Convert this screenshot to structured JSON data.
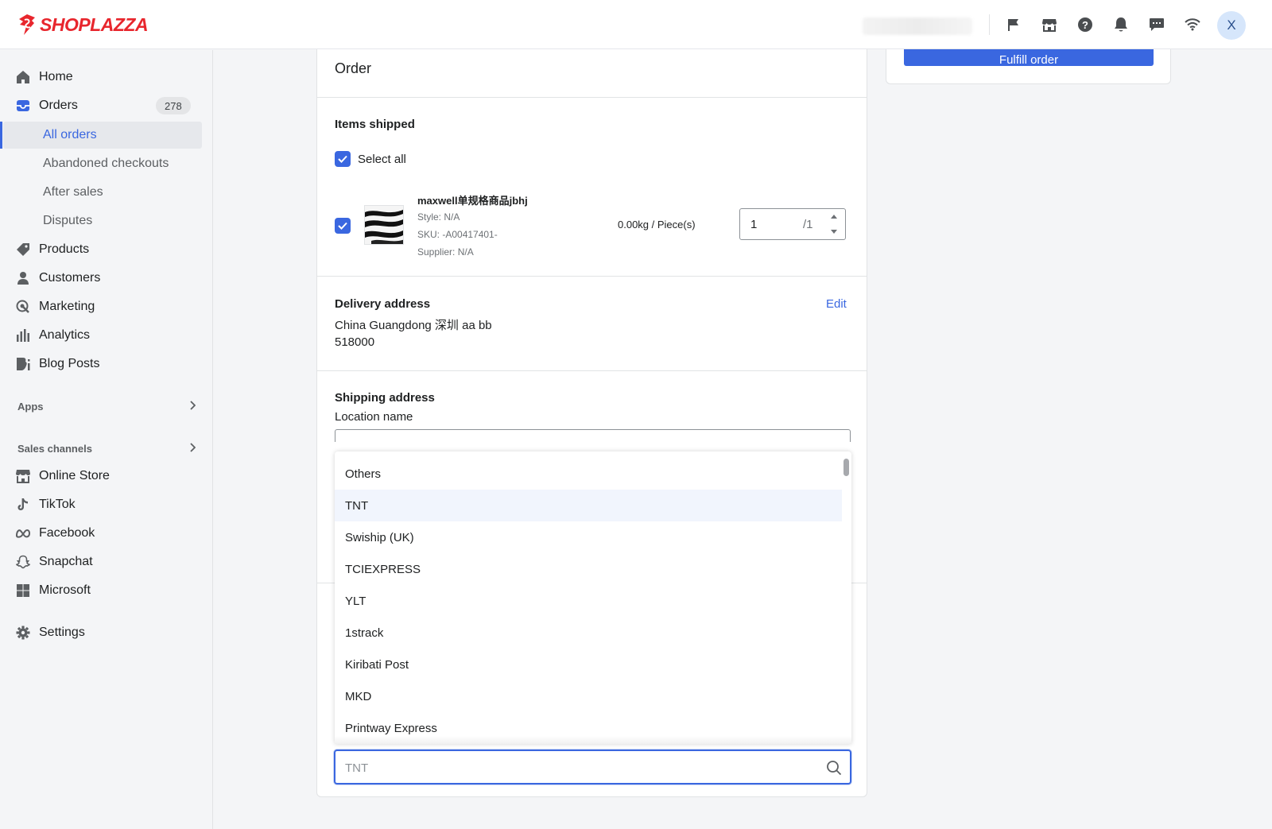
{
  "brand": {
    "name": "SHOPLAZZA",
    "color": "#e8262d"
  },
  "accent": "#3a67e0",
  "topbar": {
    "icons": [
      "flag-icon",
      "store-icon",
      "help-icon",
      "bell-icon",
      "chat-icon",
      "wifi-icon"
    ],
    "avatar_initial": "X"
  },
  "sidebar": {
    "home": "Home",
    "orders": "Orders",
    "orders_count": "278",
    "all_orders": "All orders",
    "abandoned": "Abandoned checkouts",
    "after_sales": "After sales",
    "disputes": "Disputes",
    "products": "Products",
    "customers": "Customers",
    "marketing": "Marketing",
    "analytics": "Analytics",
    "blog_posts": "Blog Posts",
    "apps": "Apps",
    "sales_channels": "Sales channels",
    "online_store": "Online Store",
    "tiktok": "TikTok",
    "facebook": "Facebook",
    "snapchat": "Snapchat",
    "microsoft": "Microsoft",
    "settings": "Settings"
  },
  "order": {
    "title": "Order",
    "items_shipped": "Items shipped",
    "select_all": "Select all",
    "product": {
      "name": "maxwell单规格商品jbhj",
      "style": "Style: N/A",
      "sku": "SKU: -A00417401-",
      "supplier": "Supplier: N/A",
      "weight": "0.00kg / Piece(s)",
      "qty": "1",
      "qty_max": "/1"
    },
    "delivery": {
      "title": "Delivery address",
      "edit": "Edit",
      "line1": "China Guangdong 深圳 aa bb",
      "line2": "518000"
    },
    "shipping": {
      "title": "Shipping address",
      "location_label": "Location name"
    }
  },
  "dropdown": {
    "options": [
      "Others",
      "TNT",
      "Swiship (UK)",
      "TCIEXPRESS",
      "YLT",
      "1strack",
      "Kiribati Post",
      "MKD",
      "Printway Express"
    ],
    "highlighted": "TNT"
  },
  "search": {
    "placeholder": "TNT"
  },
  "fulfill_button": "Fulfill order"
}
